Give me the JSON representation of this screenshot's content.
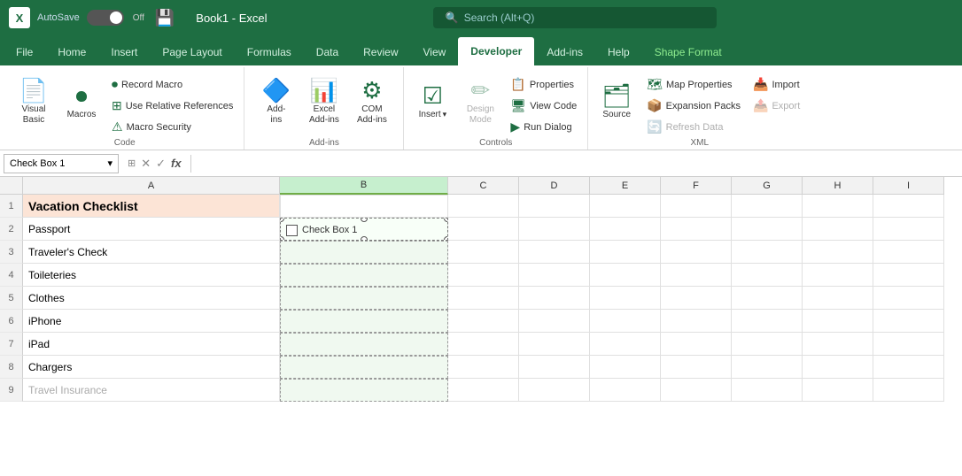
{
  "titleBar": {
    "appIcon": "X",
    "autosave": "AutoSave",
    "toggle": "Off",
    "save": "💾",
    "fileName": "Book1  -  Excel",
    "search": "Search (Alt+Q)"
  },
  "ribbonTabs": {
    "tabs": [
      "File",
      "Home",
      "Insert",
      "Page Layout",
      "Formulas",
      "Data",
      "Review",
      "View",
      "Developer",
      "Add-ins",
      "Help",
      "Shape Format"
    ],
    "activeTab": "Developer",
    "shapeFormat": "Shape Format"
  },
  "ribbonGroups": {
    "code": {
      "label": "Code",
      "visualBasic": "Visual\nBasic",
      "macros": "Macros",
      "recordMacro": "Record Macro",
      "useRelativeReferences": "Use Relative References",
      "macroSecurity": "Macro Security"
    },
    "addIns": {
      "label": "Add-ins",
      "addIns": "Add-\nins",
      "excelAddIns": "Excel\nAdd-ins",
      "comAddIns": "COM\nAdd-ins"
    },
    "controls": {
      "label": "Controls",
      "insert": "Insert",
      "designMode": "Design\nMode",
      "properties": "Properties",
      "viewCode": "View Code",
      "runDialog": "Run Dialog"
    },
    "xml": {
      "label": "XML",
      "source": "Source",
      "mapProperties": "Map Properties",
      "expansionPacks": "Expansion Packs",
      "import": "Import",
      "export": "Export",
      "refreshData": "Refresh Data"
    }
  },
  "formulaBar": {
    "nameBox": "Check Box 1",
    "dropdownArrow": "▾",
    "cancelBtn": "✕",
    "confirmBtn": "✓",
    "functionBtn": "fx"
  },
  "columns": [
    "A",
    "B",
    "C",
    "D",
    "E",
    "F",
    "G",
    "H",
    "I"
  ],
  "rows": [
    {
      "num": 1,
      "a": "Vacation Checklist",
      "b": "",
      "isTitle": true
    },
    {
      "num": 2,
      "a": "Passport",
      "b": "checkbox",
      "isSelected": true
    },
    {
      "num": 3,
      "a": "Traveler's Check",
      "b": ""
    },
    {
      "num": 4,
      "a": "Toileteries",
      "b": ""
    },
    {
      "num": 5,
      "a": "Clothes",
      "b": ""
    },
    {
      "num": 6,
      "a": "iPhone",
      "b": ""
    },
    {
      "num": 7,
      "a": "iPad",
      "b": ""
    },
    {
      "num": 8,
      "a": "Chargers",
      "b": ""
    },
    {
      "num": 9,
      "a": "Travel Insurance",
      "b": ""
    }
  ],
  "checkboxLabel": "Check Box 1",
  "colors": {
    "green": "#1e6e42",
    "lightGreen": "#e8f4ec",
    "titleBg": "#fce4d6",
    "selectedColHeader": "#c6efce"
  }
}
